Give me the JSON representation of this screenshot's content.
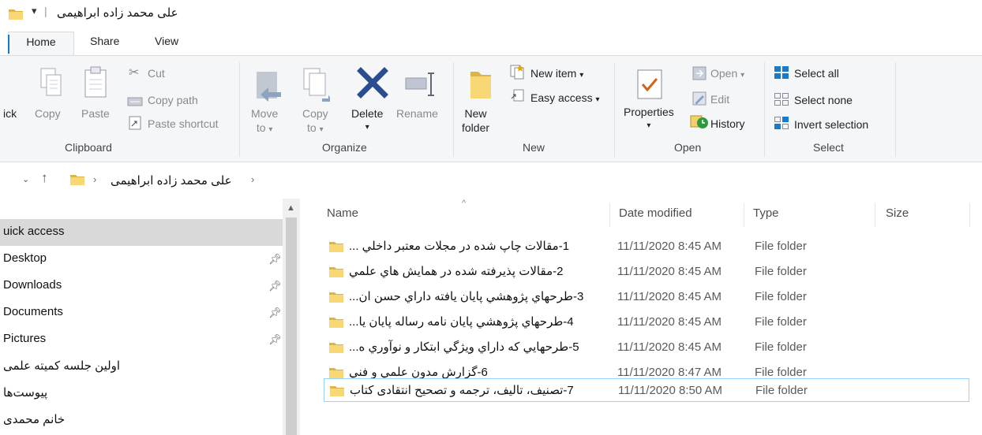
{
  "window": {
    "title": "علی محمد زاده ابراهیمی",
    "qat_glyph": "▾",
    "qat_separator": "|"
  },
  "tabs": [
    {
      "label": "Home"
    },
    {
      "label": "Share"
    },
    {
      "label": "View"
    }
  ],
  "ribbon": {
    "clipboard": {
      "pin_quick_label": "ick",
      "copy_label": "Copy",
      "paste_label": "Paste",
      "cut_label": "Cut",
      "copy_path_label": "Copy path",
      "paste_shortcut_label": "Paste shortcut",
      "group_label": "Clipboard"
    },
    "organize": {
      "move_to_label": "Move",
      "move_to_label2": "to",
      "copy_to_label": "Copy",
      "copy_to_label2": "to",
      "delete_label": "Delete",
      "rename_label": "Rename",
      "group_label": "Organize"
    },
    "new": {
      "new_folder_label": "New",
      "new_folder_label2": "folder",
      "new_item_label": "New item",
      "easy_access_label": "Easy access",
      "group_label": "New"
    },
    "open": {
      "properties_label": "Properties",
      "open_label": "Open",
      "edit_label": "Edit",
      "history_label": "History",
      "group_label": "Open"
    },
    "select": {
      "select_all_label": "Select all",
      "select_none_label": "Select none",
      "invert_selection_label": "Invert selection",
      "group_label": "Select"
    },
    "accent_color": "#1979ca"
  },
  "address": {
    "breadcrumb": "علی محمد زاده ابراهیمی"
  },
  "nav": {
    "items": [
      {
        "label": "uick access",
        "pinned": false
      },
      {
        "label": "Desktop",
        "pinned": true
      },
      {
        "label": "Downloads",
        "pinned": true
      },
      {
        "label": "Documents",
        "pinned": true
      },
      {
        "label": "Pictures",
        "pinned": true
      },
      {
        "label": "اولین جلسه کمیته علمی",
        "pinned": false
      },
      {
        "label": "پیوست‌ها",
        "pinned": false
      },
      {
        "label": "خانم محمدی",
        "pinned": false
      }
    ]
  },
  "files": {
    "columns": {
      "name": "Name",
      "date": "Date modified",
      "type": "Type",
      "size": "Size"
    },
    "rows": [
      {
        "name": "1-مقالات چاپ شده در مجلات معتبر داخلي ...",
        "date": "11/11/2020 8:45 AM",
        "type": "File folder"
      },
      {
        "name": "2-مقالات پذيرفته شده در همايش هاي علمي",
        "date": "11/11/2020 8:45 AM",
        "type": "File folder"
      },
      {
        "name": "3-طرحهاي پژوهشي پايان يافته داراي حسن ان...",
        "date": "11/11/2020 8:45 AM",
        "type": "File folder"
      },
      {
        "name": "4-طرحهاي پژوهشي پايان نامه رساله پايان يا...",
        "date": "11/11/2020 8:45 AM",
        "type": "File folder"
      },
      {
        "name": "5-طرحهايي كه داراي ويژگي ابتكار و نوآوري ه...",
        "date": "11/11/2020 8:45 AM",
        "type": "File folder"
      },
      {
        "name": "6-گزارش مدون علمي و فني",
        "date": "11/11/2020 8:47 AM",
        "type": "File folder"
      },
      {
        "name": "7-تصنیف، تالیف، ترجمه و تصحیح انتقادی کتاب",
        "date": "11/11/2020 8:50 AM",
        "type": "File folder"
      }
    ]
  }
}
